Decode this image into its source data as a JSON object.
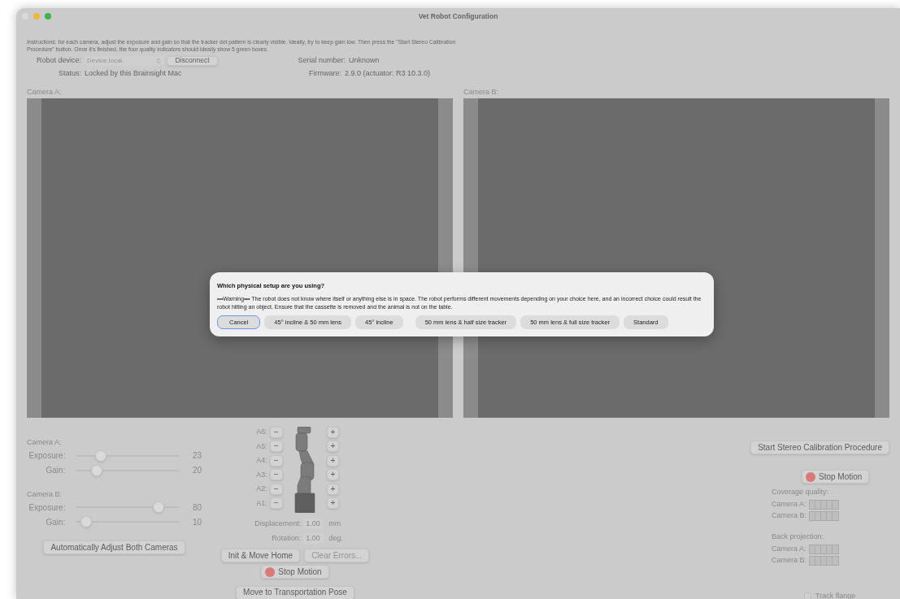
{
  "window": {
    "title": "Vet Robot Configuration"
  },
  "instructions": "Instructions: for each camera, adjust the exposure and gain so that the tracker dot pattern is clearly visible. Ideally, try to keep gain low. Then press the \"Start Stereo Calibration Procedure\" button. Once it's finished, the four quality indicators should ideally show 5 green boxes.",
  "robot_device": {
    "label": "Robot device:",
    "value": "Device.local.",
    "disabled": true
  },
  "disconnect_button": "Disconnect",
  "status": {
    "label": "Status:",
    "value": "Locked by this Brainsight Mac"
  },
  "serial_number": {
    "label": "Serial number:",
    "value": "Unknown"
  },
  "firmware": {
    "label": "Firmware:",
    "value": "2.9.0 (actuator: R3 10.3.0)"
  },
  "cameras": [
    {
      "label": "Camera A:"
    },
    {
      "label": "Camera B:"
    }
  ],
  "camera_controls": [
    {
      "label": "Camera A:",
      "sliders": [
        {
          "label": "Exposure:",
          "level": 0.24,
          "reading": "23"
        },
        {
          "label": "Gain:",
          "level": 0.2,
          "reading": "20"
        }
      ]
    },
    {
      "label": "Camera B:",
      "sliders": [
        {
          "label": "Exposure:",
          "level": 0.8,
          "reading": "80"
        },
        {
          "label": "Gain:",
          "level": 0.1,
          "reading": "10"
        }
      ]
    }
  ],
  "auto_adjust_button": "Automatically Adjust Both Cameras",
  "axes": [
    {
      "label": "A6:",
      "minus": "−",
      "plus": "+"
    },
    {
      "label": "A5:",
      "minus": "−",
      "plus": "+"
    },
    {
      "label": "A4:",
      "minus": "−",
      "plus": "+"
    },
    {
      "label": "A3:",
      "minus": "−",
      "plus": "+"
    },
    {
      "label": "A2:",
      "minus": "−",
      "plus": "+"
    },
    {
      "label": "A1:",
      "minus": "−",
      "plus": "+"
    }
  ],
  "steps": [
    {
      "label": "Displacement:",
      "value": "1.00",
      "unit": "mm"
    },
    {
      "label": "Rotation:",
      "value": "1.00",
      "unit": "deg."
    }
  ],
  "robot_buttons": [
    {
      "label": "Init & Move Home",
      "disabled": false
    },
    {
      "label": "Clear Errors...",
      "disabled": true
    }
  ],
  "stop_motion_left": "Stop Motion",
  "transport_button": "Move to Transportation Pose",
  "calibration_button": "Start Stereo Calibration Procedure",
  "stop_motion_right": "Stop Motion",
  "quality_groups": [
    {
      "title": "Coverage quality:",
      "rows": [
        {
          "label": "Camera A:"
        },
        {
          "label": "Camera B:"
        }
      ]
    },
    {
      "title": "Back projection:",
      "rows": [
        {
          "label": "Camera A:"
        },
        {
          "label": "Camera B:"
        }
      ]
    }
  ],
  "track_flange": {
    "label": "Track flange",
    "checked": false
  },
  "dialog": {
    "title": "Which physical setup are you using?",
    "message": "•••Warning••• The robot does not know where itself or anything else is in space. The robot performs different movements depending on your choice here, and an incorrect choice could result the robot hitting an object. Ensure that the cassette is removed and the animal is not on the table.",
    "buttons": [
      {
        "label": "Cancel",
        "selected": true
      },
      {
        "label": "45° incline & 50 mm lens",
        "selected": false
      },
      {
        "label": "45° incline",
        "selected": false
      },
      {
        "label": "50 mm lens & half size tracker",
        "selected": false
      },
      {
        "label": "50 mm lens & full size tracker",
        "selected": false
      },
      {
        "label": "Standard",
        "selected": false
      }
    ]
  }
}
